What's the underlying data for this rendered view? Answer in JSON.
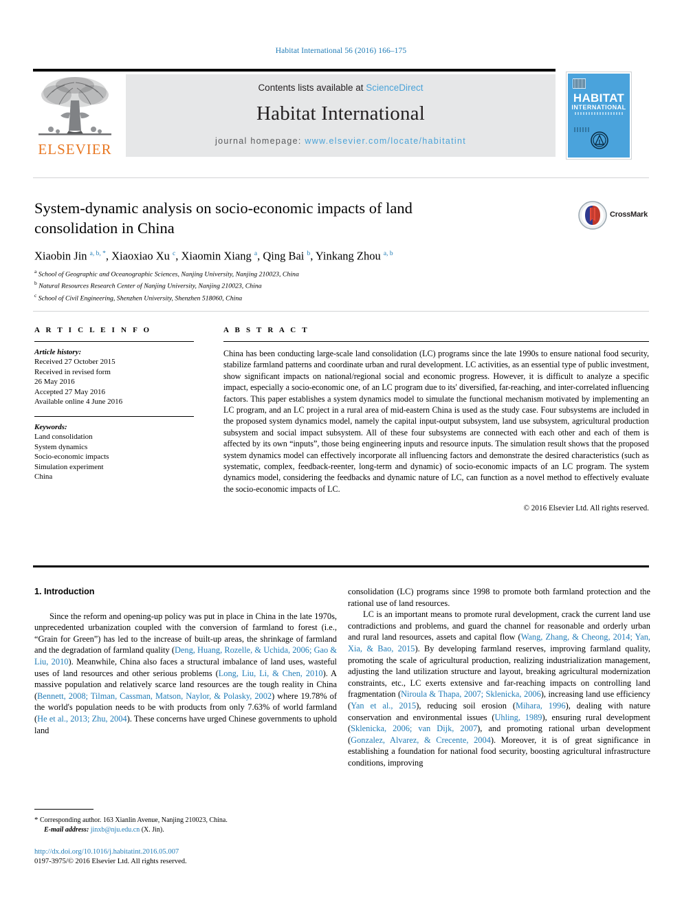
{
  "running_head": "Habitat International 56 (2016) 166–175",
  "masthead": {
    "contents_prefix": "Contents lists available at ",
    "sciencedirect": "ScienceDirect",
    "journal_name": "Habitat International",
    "homepage_prefix": "journal homepage: ",
    "homepage_url": "www.elsevier.com/locate/habitatint",
    "publisher_wordmark": "ELSEVIER",
    "cover": {
      "title_line1": "HABITAT",
      "title_line2": "INTERNATIONAL"
    }
  },
  "article": {
    "title": "System-dynamic analysis on socio-economic impacts of land consolidation in China",
    "crossmark_label": "CrossMark",
    "authors_html": "Xiaobin Jin <sup>a, b, *</sup>, Xiaoxiao Xu <sup>c</sup>, Xiaomin Xiang <sup>a</sup>, Qing Bai <sup>b</sup>, Yinkang Zhou <sup>a, b</sup>",
    "affiliations": [
      {
        "marker": "a",
        "text": "School of Geographic and Oceanographic Sciences, Nanjing University, Nanjing 210023, China"
      },
      {
        "marker": "b",
        "text": "Natural Resources Research Center of Nanjing University, Nanjing 210023, China"
      },
      {
        "marker": "c",
        "text": "School of Civil Engineering, Shenzhen University, Shenzhen 518060, China"
      }
    ]
  },
  "article_info": {
    "heading": "A R T I C L E  I N F O",
    "history_label": "Article history:",
    "history": [
      "Received 27 October 2015",
      "Received in revised form",
      "26 May 2016",
      "Accepted 27 May 2016",
      "Available online 4 June 2016"
    ],
    "keywords_label": "Keywords:",
    "keywords": [
      "Land consolidation",
      "System dynamics",
      "Socio-economic impacts",
      "Simulation experiment",
      "China"
    ]
  },
  "abstract": {
    "heading": "A B S T R A C T",
    "text": "China has been conducting large-scale land consolidation (LC) programs since the late 1990s to ensure national food security, stabilize farmland patterns and coordinate urban and rural development. LC activities, as an essential type of public investment, show significant impacts on national/regional social and economic progress. However, it is difficult to analyze a specific impact, especially a socio-economic one, of an LC program due to its' diversified, far-reaching, and inter-correlated influencing factors. This paper establishes a system dynamics model to simulate the functional mechanism motivated by implementing an LC program, and an LC project in a rural area of mid-eastern China is used as the study case. Four subsystems are included in the proposed system dynamics model, namely the capital input-output subsystem, land use subsystem, agricultural production subsystem and social impact subsystem. All of these four subsystems are connected with each other and each of them is affected by its own “inputs”, those being engineering inputs and resource inputs. The simulation result shows that the proposed system dynamics model can effectively incorporate all influencing factors and demonstrate the desired characteristics (such as systematic, complex, feedback-reenter, long-term and dynamic) of socio-economic impacts of an LC program. The system dynamics model, considering the feedbacks and dynamic nature of LC, can function as a novel method to effectively evaluate the socio-economic impacts of LC.",
    "copyright": "© 2016 Elsevier Ltd. All rights reserved."
  },
  "body": {
    "section_title": "1. Introduction",
    "left_paragraphs_html": [
      "Since the reform and opening-up policy was put in place in China in the late 1970s, unprecedented urbanization coupled with the conversion of farmland to forest (i.e., “Grain for Green”) has led to the increase of built-up areas, the shrinkage of farmland and the degradation of farmland quality (<span class=\"ref\">Deng, Huang, Rozelle, &amp; Uchida, 2006; Gao &amp; Liu, 2010</span>). Meanwhile, China also faces a structural imbalance of land uses, wasteful uses of land resources and other serious problems (<span class=\"ref\">Long, Liu, Li, &amp; Chen, 2010</span>). A massive population and relatively scarce land resources are the tough reality in China (<span class=\"ref\">Bennett, 2008; Tilman, Cassman, Matson, Naylor, &amp; Polasky, 2002</span>) where 19.78% of the world's population needs to be with products from only 7.63% of world farmland (<span class=\"ref\">He et al., 2013; Zhu, 2004</span>). These concerns have urged Chinese governments to uphold land"
    ],
    "right_paragraphs_html": [
      "consolidation (LC) programs since 1998 to promote both farmland protection and the rational use of land resources.",
      "LC is an important means to promote rural development, crack the current land use contradictions and problems, and guard the channel for reasonable and orderly urban and rural land resources, assets and capital flow (<span class=\"ref\">Wang, Zhang, &amp; Cheong, 2014; Yan, Xia, &amp; Bao, 2015</span>). By developing farmland reserves, improving farmland quality, promoting the scale of agricultural production, realizing industrialization management, adjusting the land utilization structure and layout, breaking agricultural modernization constraints, etc., LC exerts extensive and far-reaching impacts on controlling land fragmentation (<span class=\"ref\">Niroula &amp; Thapa, 2007; Sklenicka, 2006</span>), increasing land use efficiency (<span class=\"ref\">Yan et al., 2015</span>), reducing soil erosion (<span class=\"ref\">Mihara, 1996</span>), dealing with nature conservation and environmental issues (<span class=\"ref\">Uhling, 1989</span>), ensuring rural development (<span class=\"ref\">Sklenicka, 2006; van Dijk, 2007</span>), and promoting rational urban development (<span class=\"ref\">Gonzalez, Alvarez, &amp; Crecente, 2004</span>). Moreover, it is of great significance in establishing a foundation for national food security, boosting agricultural infrastructure conditions, improving"
    ]
  },
  "footnote": {
    "corresponding_html": "<span style=\"font-size:11px\">*</span> Corresponding author. 163 Xianlin Avenue, Nanjing 210023, China.",
    "email_label": "E-mail address:",
    "email": "jinxb@nju.edu.cn",
    "email_suffix": "(X. Jin)."
  },
  "doi": {
    "url": "http://dx.doi.org/10.1016/j.habitatint.2016.05.007",
    "issn_line": "0197-3975/© 2016 Elsevier Ltd. All rights reserved."
  },
  "colors": {
    "link_blue": "#1f7bb6",
    "sciencedirect_blue": "#4ba3d8",
    "elsevier_orange": "#e87722",
    "cover_blue": "#4aa3dc",
    "panel_grey": "#e6e7e8"
  }
}
